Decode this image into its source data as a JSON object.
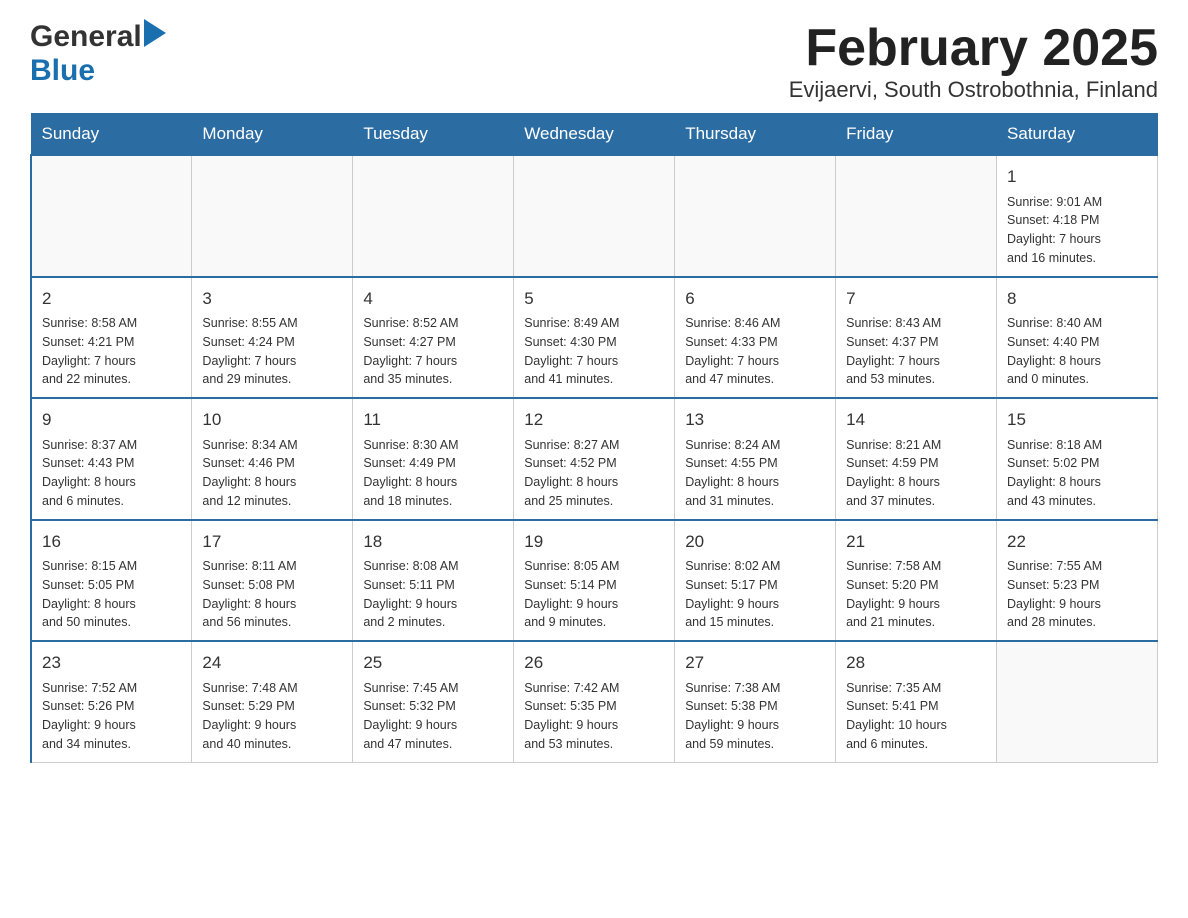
{
  "header": {
    "logo_general": "General",
    "logo_blue": "Blue",
    "title": "February 2025",
    "subtitle": "Evijaervi, South Ostrobothnia, Finland"
  },
  "weekdays": [
    "Sunday",
    "Monday",
    "Tuesday",
    "Wednesday",
    "Thursday",
    "Friday",
    "Saturday"
  ],
  "weeks": [
    [
      {
        "day": "",
        "info": ""
      },
      {
        "day": "",
        "info": ""
      },
      {
        "day": "",
        "info": ""
      },
      {
        "day": "",
        "info": ""
      },
      {
        "day": "",
        "info": ""
      },
      {
        "day": "",
        "info": ""
      },
      {
        "day": "1",
        "info": "Sunrise: 9:01 AM\nSunset: 4:18 PM\nDaylight: 7 hours\nand 16 minutes."
      }
    ],
    [
      {
        "day": "2",
        "info": "Sunrise: 8:58 AM\nSunset: 4:21 PM\nDaylight: 7 hours\nand 22 minutes."
      },
      {
        "day": "3",
        "info": "Sunrise: 8:55 AM\nSunset: 4:24 PM\nDaylight: 7 hours\nand 29 minutes."
      },
      {
        "day": "4",
        "info": "Sunrise: 8:52 AM\nSunset: 4:27 PM\nDaylight: 7 hours\nand 35 minutes."
      },
      {
        "day": "5",
        "info": "Sunrise: 8:49 AM\nSunset: 4:30 PM\nDaylight: 7 hours\nand 41 minutes."
      },
      {
        "day": "6",
        "info": "Sunrise: 8:46 AM\nSunset: 4:33 PM\nDaylight: 7 hours\nand 47 minutes."
      },
      {
        "day": "7",
        "info": "Sunrise: 8:43 AM\nSunset: 4:37 PM\nDaylight: 7 hours\nand 53 minutes."
      },
      {
        "day": "8",
        "info": "Sunrise: 8:40 AM\nSunset: 4:40 PM\nDaylight: 8 hours\nand 0 minutes."
      }
    ],
    [
      {
        "day": "9",
        "info": "Sunrise: 8:37 AM\nSunset: 4:43 PM\nDaylight: 8 hours\nand 6 minutes."
      },
      {
        "day": "10",
        "info": "Sunrise: 8:34 AM\nSunset: 4:46 PM\nDaylight: 8 hours\nand 12 minutes."
      },
      {
        "day": "11",
        "info": "Sunrise: 8:30 AM\nSunset: 4:49 PM\nDaylight: 8 hours\nand 18 minutes."
      },
      {
        "day": "12",
        "info": "Sunrise: 8:27 AM\nSunset: 4:52 PM\nDaylight: 8 hours\nand 25 minutes."
      },
      {
        "day": "13",
        "info": "Sunrise: 8:24 AM\nSunset: 4:55 PM\nDaylight: 8 hours\nand 31 minutes."
      },
      {
        "day": "14",
        "info": "Sunrise: 8:21 AM\nSunset: 4:59 PM\nDaylight: 8 hours\nand 37 minutes."
      },
      {
        "day": "15",
        "info": "Sunrise: 8:18 AM\nSunset: 5:02 PM\nDaylight: 8 hours\nand 43 minutes."
      }
    ],
    [
      {
        "day": "16",
        "info": "Sunrise: 8:15 AM\nSunset: 5:05 PM\nDaylight: 8 hours\nand 50 minutes."
      },
      {
        "day": "17",
        "info": "Sunrise: 8:11 AM\nSunset: 5:08 PM\nDaylight: 8 hours\nand 56 minutes."
      },
      {
        "day": "18",
        "info": "Sunrise: 8:08 AM\nSunset: 5:11 PM\nDaylight: 9 hours\nand 2 minutes."
      },
      {
        "day": "19",
        "info": "Sunrise: 8:05 AM\nSunset: 5:14 PM\nDaylight: 9 hours\nand 9 minutes."
      },
      {
        "day": "20",
        "info": "Sunrise: 8:02 AM\nSunset: 5:17 PM\nDaylight: 9 hours\nand 15 minutes."
      },
      {
        "day": "21",
        "info": "Sunrise: 7:58 AM\nSunset: 5:20 PM\nDaylight: 9 hours\nand 21 minutes."
      },
      {
        "day": "22",
        "info": "Sunrise: 7:55 AM\nSunset: 5:23 PM\nDaylight: 9 hours\nand 28 minutes."
      }
    ],
    [
      {
        "day": "23",
        "info": "Sunrise: 7:52 AM\nSunset: 5:26 PM\nDaylight: 9 hours\nand 34 minutes."
      },
      {
        "day": "24",
        "info": "Sunrise: 7:48 AM\nSunset: 5:29 PM\nDaylight: 9 hours\nand 40 minutes."
      },
      {
        "day": "25",
        "info": "Sunrise: 7:45 AM\nSunset: 5:32 PM\nDaylight: 9 hours\nand 47 minutes."
      },
      {
        "day": "26",
        "info": "Sunrise: 7:42 AM\nSunset: 5:35 PM\nDaylight: 9 hours\nand 53 minutes."
      },
      {
        "day": "27",
        "info": "Sunrise: 7:38 AM\nSunset: 5:38 PM\nDaylight: 9 hours\nand 59 minutes."
      },
      {
        "day": "28",
        "info": "Sunrise: 7:35 AM\nSunset: 5:41 PM\nDaylight: 10 hours\nand 6 minutes."
      },
      {
        "day": "",
        "info": ""
      }
    ]
  ],
  "colors": {
    "header_bg": "#2b6ca3",
    "header_text": "#ffffff",
    "border": "#2b6ca3",
    "cell_border": "#cccccc"
  }
}
